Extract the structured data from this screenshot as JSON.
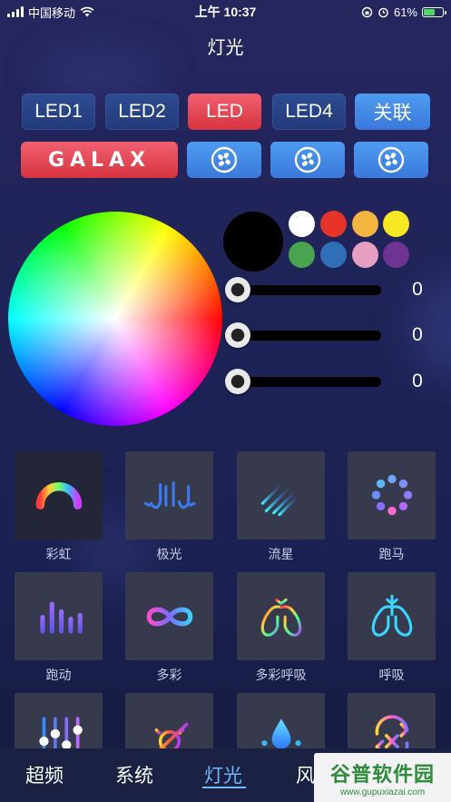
{
  "status_bar": {
    "carrier": "中国移动",
    "time": "上午 10:37",
    "battery_percent": "61%",
    "battery_level": 0.61
  },
  "page": {
    "title": "灯光"
  },
  "led_buttons": [
    {
      "label": "LED1",
      "style": "dark"
    },
    {
      "label": "LED2",
      "style": "dark"
    },
    {
      "label": "LED",
      "style": "red"
    },
    {
      "label": "LED4",
      "style": "dark"
    },
    {
      "label": "关联",
      "style": "blue"
    }
  ],
  "device_buttons": {
    "logo": "GALAX",
    "fans": [
      {
        "icon": "fan-icon"
      },
      {
        "icon": "fan-icon"
      },
      {
        "icon": "fan-icon"
      }
    ]
  },
  "color_picker": {
    "current_color": "#000000",
    "presets": [
      "#ffffff",
      "#e8332a",
      "#f4b53f",
      "#f8e823",
      "#48a44e",
      "#2e6fb8",
      "#e8a0c2",
      "#6f3393"
    ]
  },
  "sliders": [
    {
      "value": "0"
    },
    {
      "value": "0"
    },
    {
      "value": "0"
    }
  ],
  "effects": [
    {
      "label": "彩虹",
      "icon": "rainbow-icon",
      "active": true
    },
    {
      "label": "极光",
      "icon": "aurora-icon"
    },
    {
      "label": "流星",
      "icon": "meteor-icon"
    },
    {
      "label": "跑马",
      "icon": "marquee-icon"
    },
    {
      "label": "跑动",
      "icon": "running-bars-icon"
    },
    {
      "label": "多彩",
      "icon": "infinity-icon"
    },
    {
      "label": "多彩呼吸",
      "icon": "colorful-breath-icon"
    },
    {
      "label": "呼吸",
      "icon": "breath-icon"
    },
    {
      "label": "",
      "icon": "equalizer-icon"
    },
    {
      "label": "",
      "icon": "sun-icon"
    },
    {
      "label": "",
      "icon": "water-drop-icon"
    },
    {
      "label": "",
      "icon": "swap-arrows-icon"
    }
  ],
  "bottom_nav": [
    {
      "label": "超频",
      "active": false
    },
    {
      "label": "系统",
      "active": false
    },
    {
      "label": "灯光",
      "active": true
    },
    {
      "label": "风",
      "active": false
    }
  ],
  "watermark": {
    "top": "谷普软件园",
    "bottom": "www.gupuxiazai.com"
  }
}
